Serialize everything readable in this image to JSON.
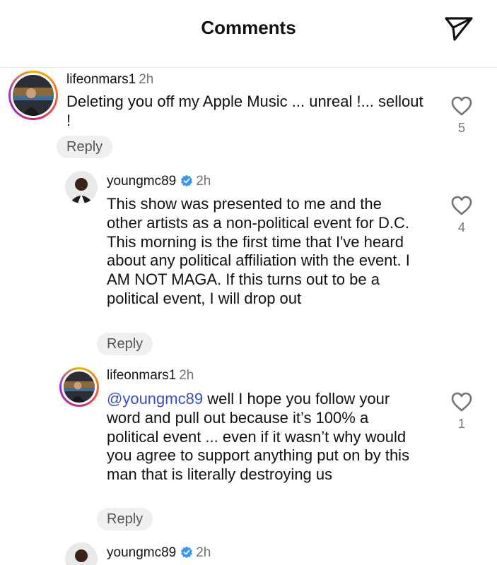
{
  "header": {
    "title": "Comments",
    "share_icon": "send-icon"
  },
  "comments": [
    {
      "username": "lifeonmars1",
      "time": "2h",
      "verified": false,
      "text": "Deleting you off my Apple Music ... unreal !... sellout !",
      "reply_label": "Reply",
      "likes": "5"
    },
    {
      "username": "youngmc89",
      "time": "2h",
      "verified": true,
      "text": "This show was presented to me and the other artists as a non-political event for D.C. This morning is the first time that I've heard about any political affiliation with the event. I AM NOT MAGA. If this turns out to be a political event, I will drop out",
      "reply_label": "Reply",
      "likes": "4"
    },
    {
      "username": "lifeonmars1",
      "time": "2h",
      "verified": false,
      "mention": "@youngmc89",
      "text": "well I hope you follow your word and pull out because it’s 100% a political event ... even if it wasn’t why would you agree to support anything put on by this man that is literally destroying us",
      "reply_label": "Reply",
      "likes": "1"
    },
    {
      "username": "youngmc89",
      "time": "2h",
      "verified": true
    }
  ],
  "colors": {
    "mention": "#3a4fc0",
    "verified": "#3897f0",
    "secondary_text": "#737373"
  }
}
